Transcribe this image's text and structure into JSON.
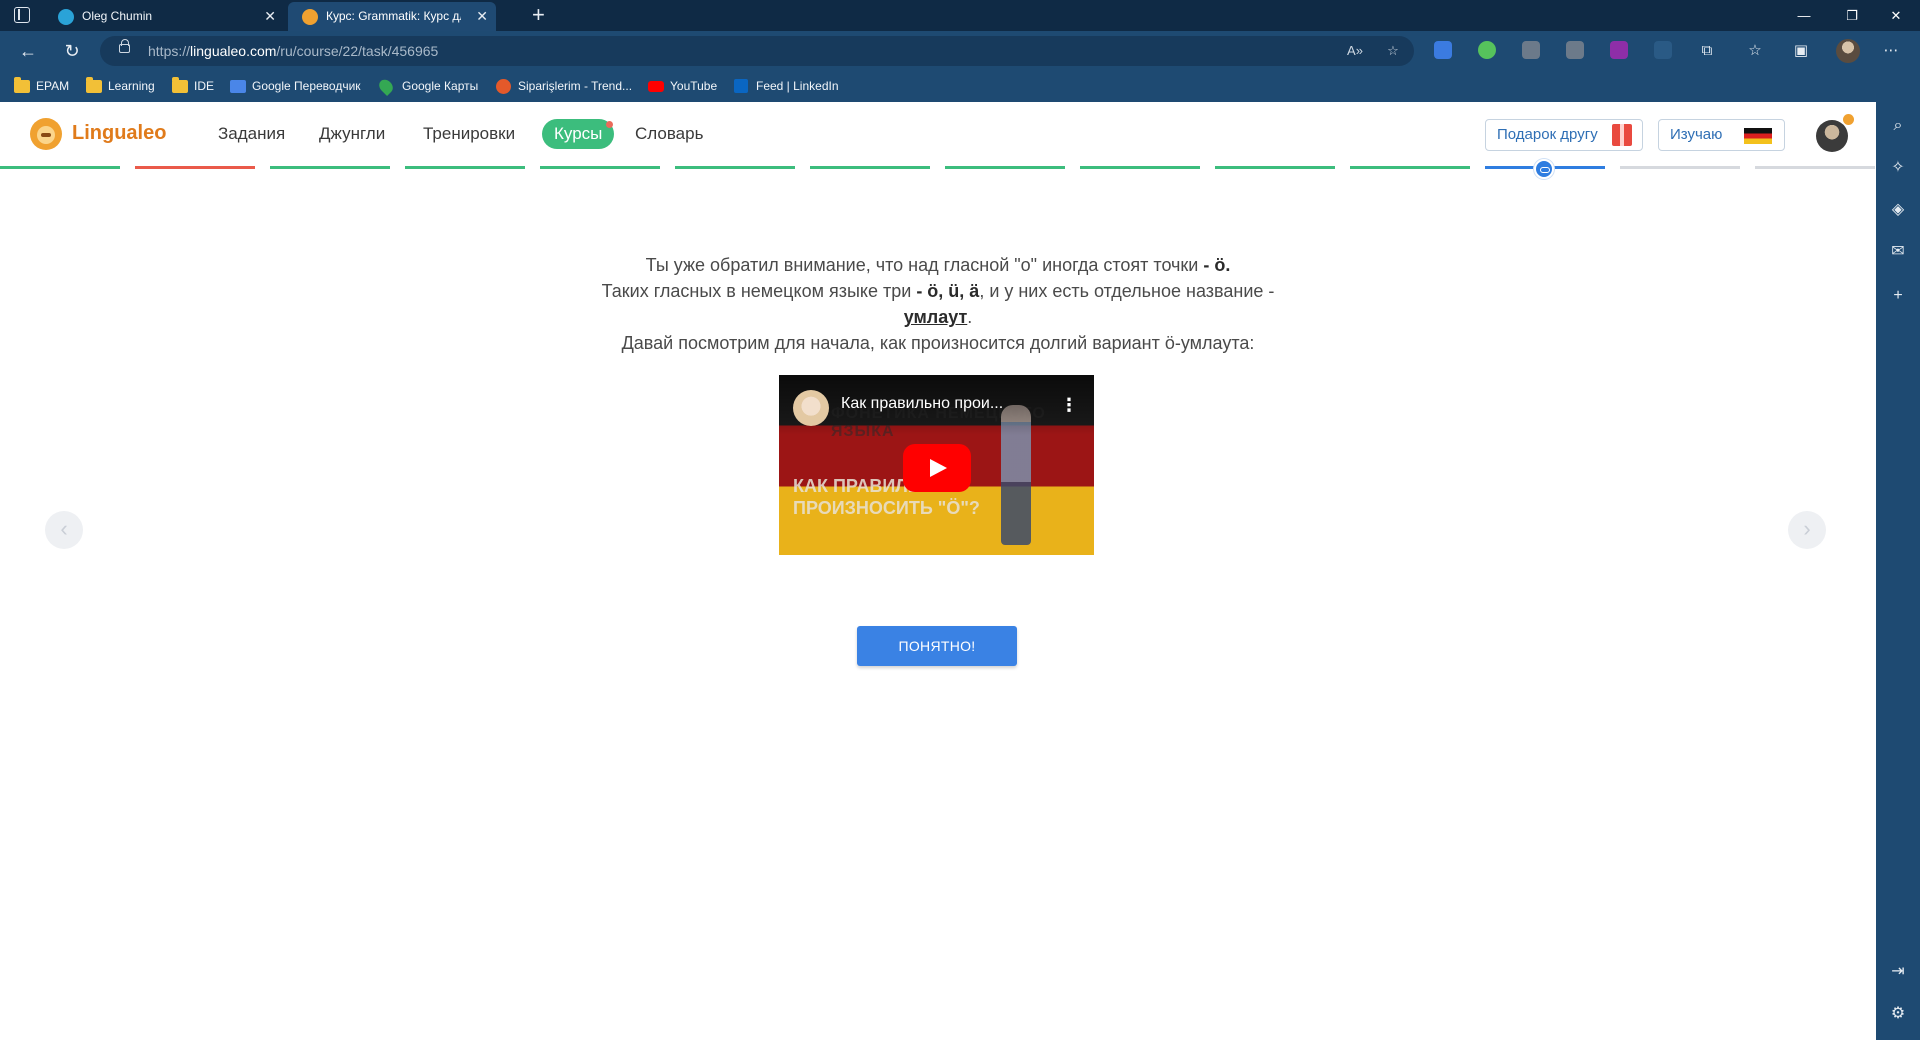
{
  "browser": {
    "tabs": [
      {
        "title": "Oleg Chumin",
        "favicon_color": "#2aa3d8"
      },
      {
        "title": "Курс: Grammatik: Курс для начинающих",
        "favicon_color": "#f0a130"
      }
    ],
    "url": {
      "scheme": "https://",
      "host": "lingualeo.com",
      "path": "/ru/course/22/task/456965"
    },
    "bookmarks": [
      {
        "label": "EPAM",
        "icon": "folder-icon"
      },
      {
        "label": "Learning",
        "icon": "folder-icon"
      },
      {
        "label": "IDE",
        "icon": "folder-icon"
      },
      {
        "label": "Google Переводчик",
        "icon": "google-translate-icon"
      },
      {
        "label": "Google Карты",
        "icon": "google-maps-icon"
      },
      {
        "label": "Siparişlerim - Trend...",
        "icon": "trendyol-icon"
      },
      {
        "label": "YouTube",
        "icon": "youtube-icon"
      },
      {
        "label": "Feed | LinkedIn",
        "icon": "linkedin-icon"
      }
    ]
  },
  "site": {
    "logo": "Lingualeo",
    "nav": [
      "Задания",
      "Джунгли",
      "Тренировки",
      "Курсы",
      "Словарь"
    ],
    "active_nav": "Курсы",
    "gift_button": "Подарок другу",
    "learning_button": "Изучаю"
  },
  "lesson": {
    "line1_text": "Ты уже обратил внимание, что над гласной \"о\" иногда стоят точки",
    "line1_bold": "- ö.",
    "line2_text_a": "Таких гласных в немецком языке три",
    "line2_bold": "- ö, ü, ä",
    "line2_text_b": ", и у них есть отдельное название -",
    "term": "умлаут",
    "term_after": ".",
    "line3_text": "Давай посмотрим для начала, как произносится долгий вариант ö-умлаута:"
  },
  "video": {
    "title": "Как правильно прои...",
    "bg_text_top": "ФОНЕТИКА НЕМЕЦКОГО ЯЗЫКА",
    "bg_text_bottom_1": "КАК ПРАВИЛЬНО",
    "bg_text_bottom_2": "ПРОИЗНОСИТЬ \"Ö\"?"
  },
  "actions": {
    "ok_button": "ПОНЯТНО!"
  },
  "progress": {
    "segments": 13,
    "current_index": 11,
    "colors": {
      "done": "#3cbd7d",
      "error": "#ea5a4a",
      "current": "#2f7de0",
      "upcoming": "#d6d9de"
    }
  },
  "colors": {
    "brand": "#e07b1b",
    "accent_green": "#3cbd7d",
    "primary_blue": "#3a82e4"
  }
}
